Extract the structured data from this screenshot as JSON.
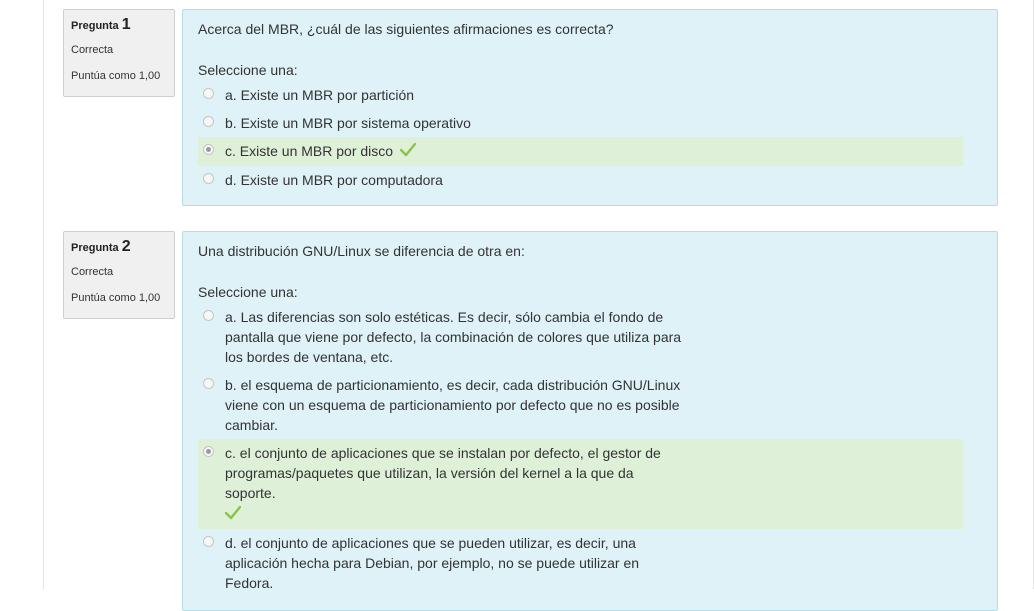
{
  "questions": [
    {
      "label": "Pregunta",
      "number": "1",
      "state": "Correcta",
      "grade": "Puntúa como 1,00",
      "text": "Acerca del MBR, ¿cuál de las siguientes afirmaciones es correcta?",
      "prompt": "Seleccione una:",
      "answers": [
        {
          "text": "a. Existe un MBR por partición",
          "selected": false,
          "correct": false
        },
        {
          "text": "b. Existe un MBR por sistema operativo",
          "selected": false,
          "correct": false
        },
        {
          "text": "c. Existe un MBR por disco",
          "selected": true,
          "correct": true
        },
        {
          "text": "d. Existe un MBR por computadora",
          "selected": false,
          "correct": false
        }
      ]
    },
    {
      "label": "Pregunta",
      "number": "2",
      "state": "Correcta",
      "grade": "Puntúa como 1,00",
      "text": "Una distribución GNU/Linux se diferencia de otra en:",
      "prompt": "Seleccione una:",
      "answers": [
        {
          "text": "a. Las diferencias son solo estéticas. Es decir, sólo cambia el fondo de pantalla que viene por defecto, la combinación de colores que utiliza para los bordes de ventana, etc.",
          "selected": false,
          "correct": false
        },
        {
          "text": "b. el esquema de particionamiento, es decir, cada distribución GNU/Linux viene con un esquema de particionamiento por defecto que no es posible cambiar.",
          "selected": false,
          "correct": false
        },
        {
          "text": "c. el conjunto de aplicaciones que se instalan por defecto, el gestor de programas/paquetes que utilizan, la versión del kernel a la que da soporte.",
          "selected": true,
          "correct": true
        },
        {
          "text": "d. el conjunto de aplicaciones que se pueden utilizar, es decir, una aplicación hecha para Debian, por ejemplo,  no se puede utilizar en Fedora.",
          "selected": false,
          "correct": false
        }
      ]
    }
  ],
  "colors": {
    "formulation_bg": "#def2f8",
    "correct_bg": "#dff0d8",
    "check": "#8bc34a",
    "info_bg": "#f0f0f0"
  },
  "icons": {
    "correct": "check-icon"
  }
}
